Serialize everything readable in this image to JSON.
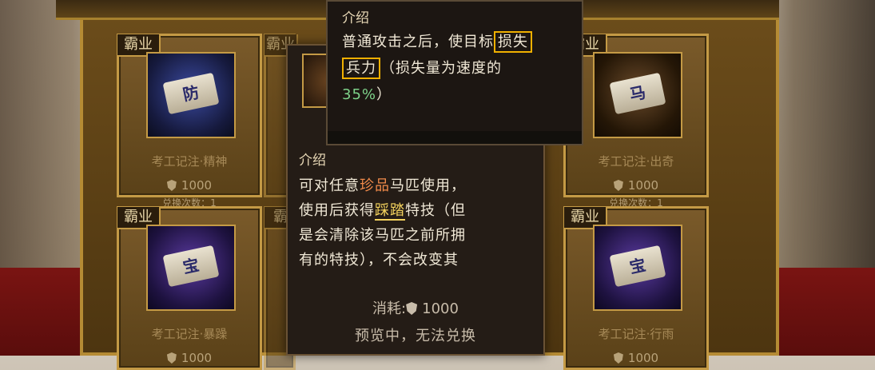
{
  "cards": [
    {
      "tag": "霸业",
      "glyph": "防",
      "name": "考工记注·精神",
      "cost": "1000",
      "limit": "兑换次数：1"
    },
    {
      "tag": "霸业",
      "glyph": "马",
      "name": "考工记注·出奇",
      "cost": "1000",
      "limit": "兑换次数：1"
    },
    {
      "tag": "霸业",
      "glyph": "宝",
      "name": "考工记注·暴躁",
      "cost": "1000",
      "limit": ""
    },
    {
      "tag": "霸业",
      "glyph": "宝",
      "name": "考工记注·行雨",
      "cost": "1000",
      "limit": ""
    }
  ],
  "hidden_tags": [
    "霸业",
    "霸",
    "霸"
  ],
  "popup": {
    "desc_title": "介绍",
    "desc_lines": [
      [
        "可对任意",
        "珍品",
        "马匹使用，"
      ],
      [
        "使用后获得",
        "踩踏",
        "特技（但"
      ],
      [
        "是会清除该马匹之前所拥"
      ],
      [
        "有的特技），不会改变其"
      ]
    ],
    "cost_label": "消耗:",
    "cost_value": "1000",
    "preview_text": "预览中，无法兑换"
  },
  "tooltip": {
    "title": "介绍",
    "line1_a": "普通攻击之后，使目标",
    "line1_hl": "损失",
    "line2_hl": "兵力",
    "line2_b": "（损失量为速度的",
    "line3_pct": "35%",
    "line3_b": "）"
  },
  "colors": {
    "accent_gold": "#c49a45",
    "highlight_box": "#f0b000",
    "green": "#7ed38a",
    "rare_red": "#f08a4a",
    "skill_yellow": "#f4d35e"
  }
}
